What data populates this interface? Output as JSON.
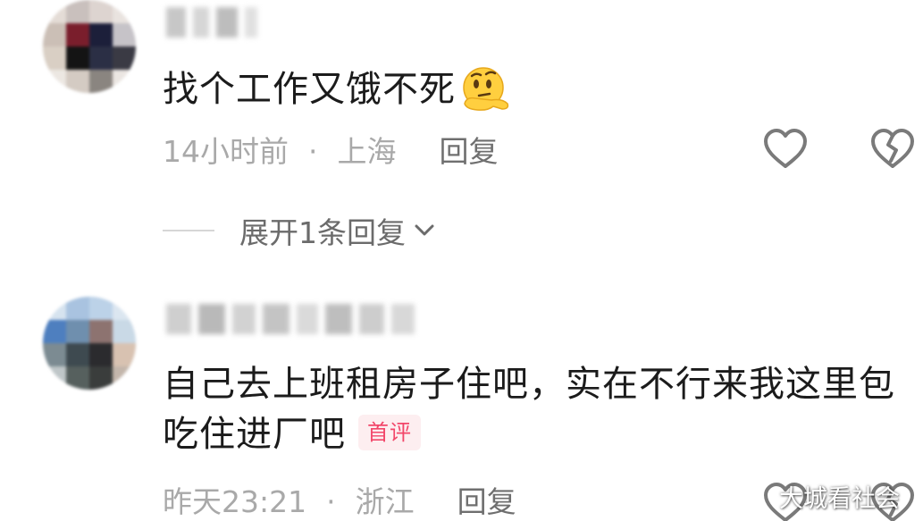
{
  "comments": [
    {
      "text": "找个工作又饿不死",
      "emoji": "thinking-face",
      "time": "14小时前",
      "separator": "·",
      "location": "上海",
      "reply_label": "回复",
      "expand_label": "展开1条回复"
    },
    {
      "text": "自己去上班租房子住吧，实在不行来我这里包吃住进厂吧",
      "badge": "首评",
      "time": "昨天23:21",
      "separator": "·",
      "location": "浙江",
      "reply_label": "回复"
    }
  ],
  "watermark": "大城看社会",
  "colors": {
    "text": "#1b1b1b",
    "meta": "#a9a9a9",
    "reply": "#6f6f6f",
    "badge_text": "#f2476a",
    "badge_bg": "#fdeef0",
    "icon": "#7a7a7a"
  }
}
